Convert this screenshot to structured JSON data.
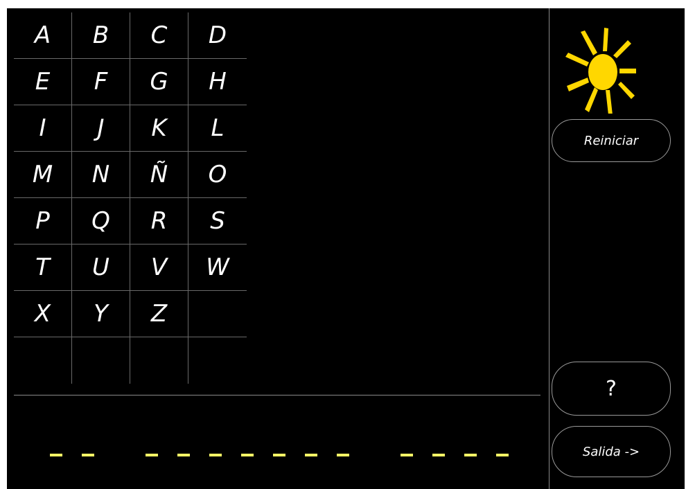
{
  "alphabet": {
    "letters": [
      "A",
      "B",
      "C",
      "D",
      "E",
      "F",
      "G",
      "H",
      "I",
      "J",
      "K",
      "L",
      "M",
      "N",
      "Ñ",
      "O",
      "P",
      "Q",
      "R",
      "S",
      "T",
      "U",
      "V",
      "W",
      "X",
      "Y",
      "Z"
    ]
  },
  "word": {
    "groups": [
      2,
      7,
      4
    ],
    "dash_color": "#ffff66"
  },
  "buttons": {
    "restart_label": "Reiniciar",
    "help_label": "?",
    "exit_label": "Salida ->"
  },
  "icons": {
    "status": "sun-icon"
  },
  "colors": {
    "background": "#000000",
    "text": "#ffffff",
    "sun": "#ffd700",
    "grid_lines": "#6a6a6a"
  }
}
